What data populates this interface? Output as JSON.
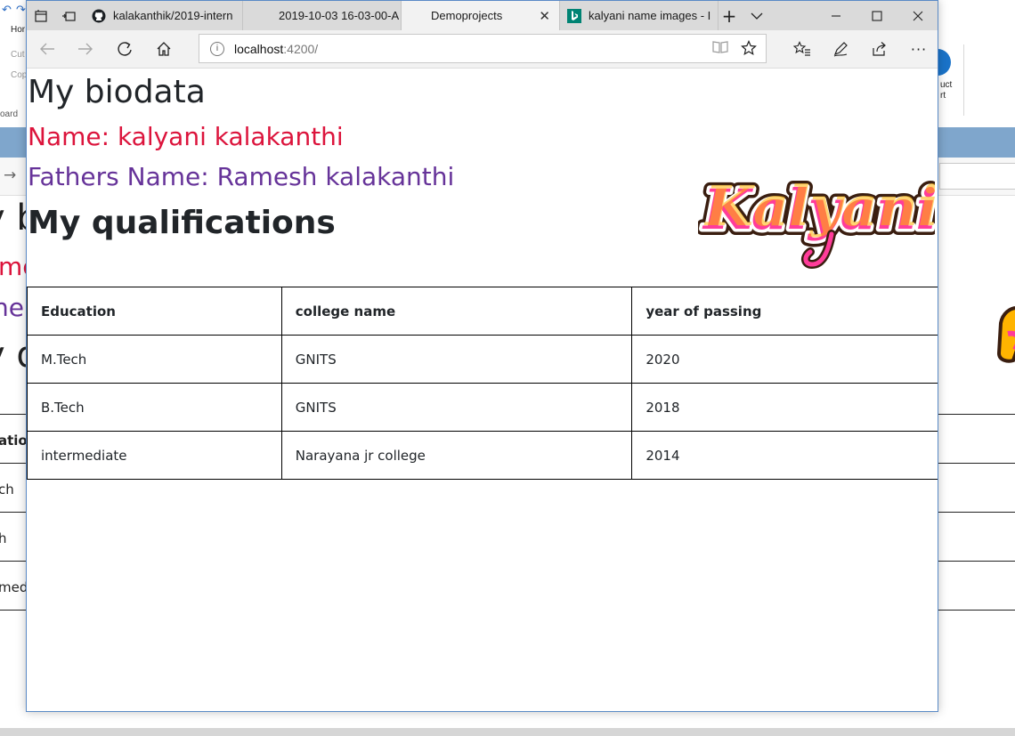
{
  "background_window": {
    "ribbon_fragments": [
      "Hor",
      "Cut",
      "Cop",
      "oard"
    ],
    "product_fragment_line1": "uct",
    "product_fragment_line2": "rt",
    "heading_fragment": "y b",
    "name_fragment": "me",
    "father_fragment": "her",
    "qual_fragment": "y q",
    "table_fragments": [
      "atio",
      "ch",
      "h",
      "medi"
    ]
  },
  "browser": {
    "tabs": [
      {
        "title": "kalakanthik/2019-intern",
        "icon": "github-icon",
        "active": false
      },
      {
        "title": "2019-10-03 16-03-00-A",
        "icon": "",
        "active": false
      },
      {
        "title": "Demoprojects",
        "icon": "",
        "active": true
      },
      {
        "title": "kalyani name images - I",
        "icon": "bing-icon",
        "active": false
      }
    ],
    "address": {
      "host": "localhost",
      "port": ":4200/"
    },
    "window_controls": [
      "minimize",
      "maximize",
      "close"
    ]
  },
  "page": {
    "heading": "My biodata",
    "name_line": "Name: kalyani kalakanthi",
    "father_line": "Fathers Name: Ramesh kalakanthi",
    "qualifications_heading": "My qualifications",
    "logo_text": "Kalyani",
    "table": {
      "headers": [
        "Education",
        "college name",
        "year of passing"
      ],
      "rows": [
        [
          "M.Tech",
          "GNITS",
          "2020"
        ],
        [
          "B.Tech",
          "GNITS",
          "2018"
        ],
        [
          "intermediate",
          "Narayana jr college",
          "2014"
        ]
      ]
    }
  },
  "colors": {
    "name_color": "#dc143c",
    "father_color": "#663399",
    "logo_fill": "#ff3c9a",
    "logo_accent": "#ffb400"
  }
}
